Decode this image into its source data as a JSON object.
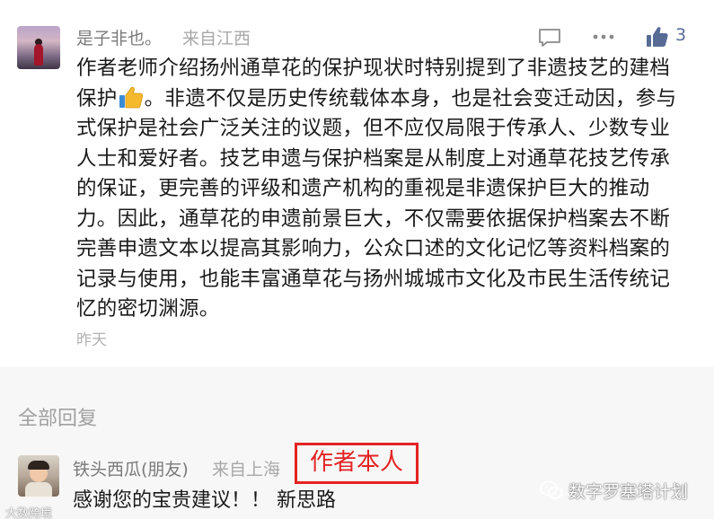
{
  "comment": {
    "username": "是子非也。",
    "location": "来自江西",
    "like_count": "3",
    "text_before_emoji": "作者老师介绍扬州通草花的保护现状时特别提到了非遗技艺的建档保护",
    "text_after_emoji": "。非遗不仅是历史传统载体本身，也是社会变迁动因，参与式保护是社会广泛关注的议题，但不应仅局限于传承人、少数专业人士和爱好者。技艺申遗与保护档案是从制度上对通草花技艺传承的保证，更完善的评级和遗产机构的重视是非遗保护巨大的推动力。因此，通草花的申遗前景巨大，不仅需要依据保护档案去不断完善申遗文本以提高其影响力，公众口述的文化记忆等资料档案的记录与使用，也能丰富通草花与扬州城城市文化及市民生活传统记忆的密切渊源。",
    "time": "昨天",
    "icons": {
      "reply": "comment-bubble-icon",
      "more": "more-dots-icon",
      "like": "thumbs-up-icon",
      "emoji": "thumbs-up-emoji"
    }
  },
  "replies": {
    "title": "全部回复",
    "items": [
      {
        "username": "铁头西瓜(朋友)",
        "location": "来自上海",
        "badge": "作者本人",
        "text": "感谢您的宝贵建议！！ 新思路"
      }
    ]
  },
  "watermarks": {
    "left": "大数跨境",
    "right": "数字罗塞塔计划"
  },
  "colors": {
    "accent_blue": "#576b95",
    "badge_red": "#e42323",
    "muted_text": "#a8a8a8",
    "reply_bg": "#f7f7f7"
  }
}
